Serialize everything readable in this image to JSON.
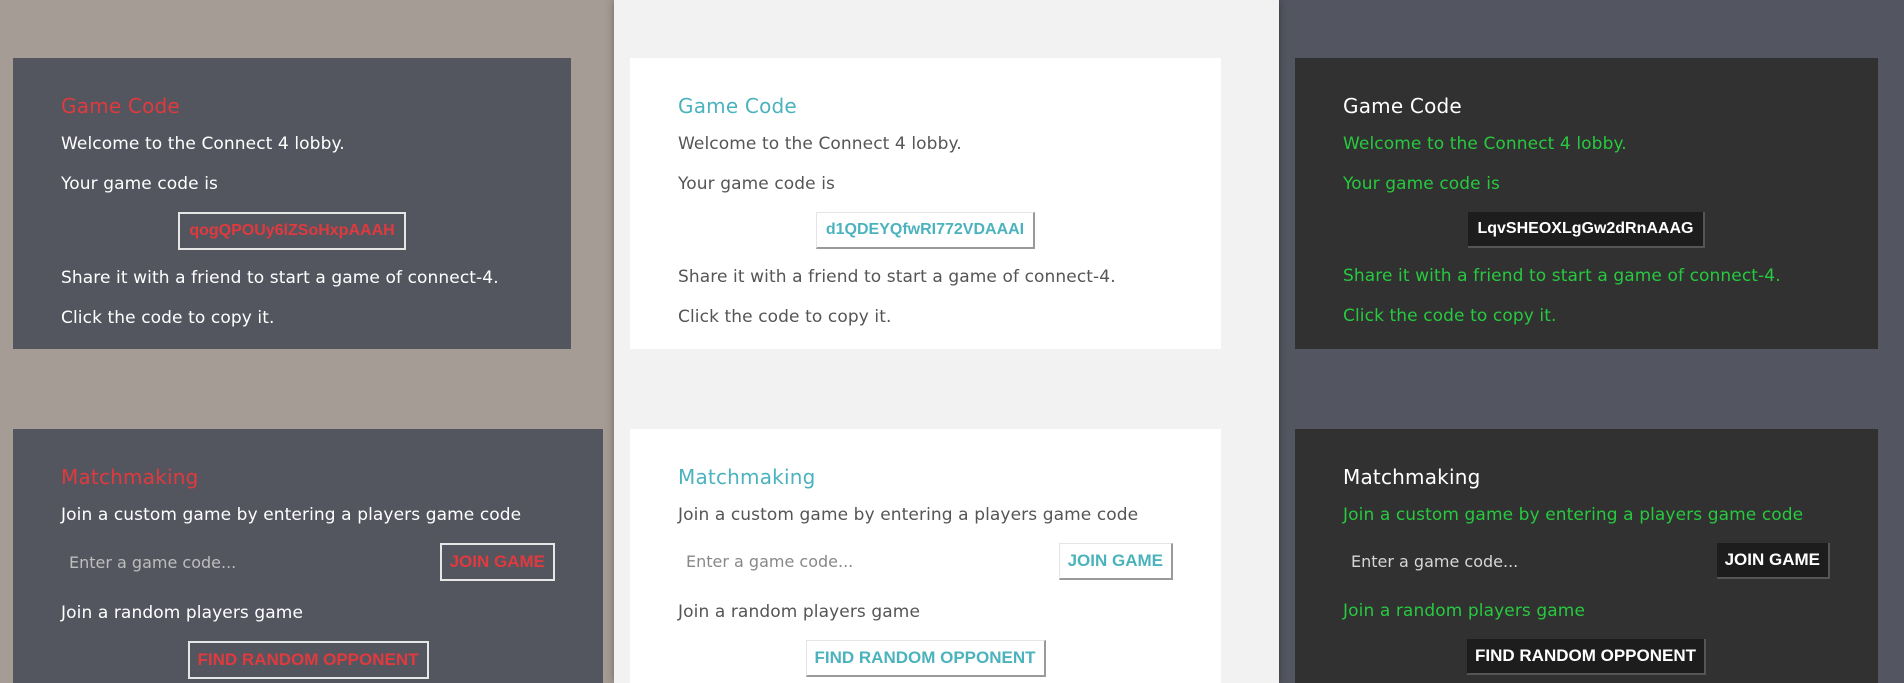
{
  "themes": [
    {
      "game_code": {
        "title": "Game Code",
        "welcome": "Welcome to the Connect 4 lobby.",
        "your_code": "Your game code is",
        "code": "qogQPOUy6lZSoHxpAAAH",
        "share": "Share it with a friend to start a game of connect-4.",
        "copy_hint": "Click the code to copy it."
      },
      "matchmaking": {
        "title": "Matchmaking",
        "custom_label": "Join a custom game by entering a players game code",
        "input_placeholder": "Enter a game code...",
        "join_button": "JOIN GAME",
        "random_label": "Join a random players game",
        "random_button": "FIND RANDOM OPPONENT"
      }
    },
    {
      "game_code": {
        "title": "Game Code",
        "welcome": "Welcome to the Connect 4 lobby.",
        "your_code": "Your game code is",
        "code": "d1QDEYQfwRI772VDAAAI",
        "share": "Share it with a friend to start a game of connect-4.",
        "copy_hint": "Click the code to copy it."
      },
      "matchmaking": {
        "title": "Matchmaking",
        "custom_label": "Join a custom game by entering a players game code",
        "input_placeholder": "Enter a game code...",
        "join_button": "JOIN GAME",
        "random_label": "Join a random players game",
        "random_button": "FIND RANDOM OPPONENT"
      }
    },
    {
      "game_code": {
        "title": "Game Code",
        "welcome": "Welcome to the Connect 4 lobby.",
        "your_code": "Your game code is",
        "code": "LqvSHEOXLgGw2dRnAAAG",
        "share": "Share it with a friend to start a game of connect-4.",
        "copy_hint": "Click the code to copy it."
      },
      "matchmaking": {
        "title": "Matchmaking",
        "custom_label": "Join a custom game by entering a players game code",
        "input_placeholder": "Enter a game code...",
        "join_button": "JOIN GAME",
        "random_label": "Join a random players game",
        "random_button": "FIND RANDOM OPPONENT"
      }
    }
  ],
  "colors": {
    "theme1_accent": "#e0393e",
    "theme2_accent": "#4bb3bd",
    "theme3_accent": "#27c93f"
  }
}
